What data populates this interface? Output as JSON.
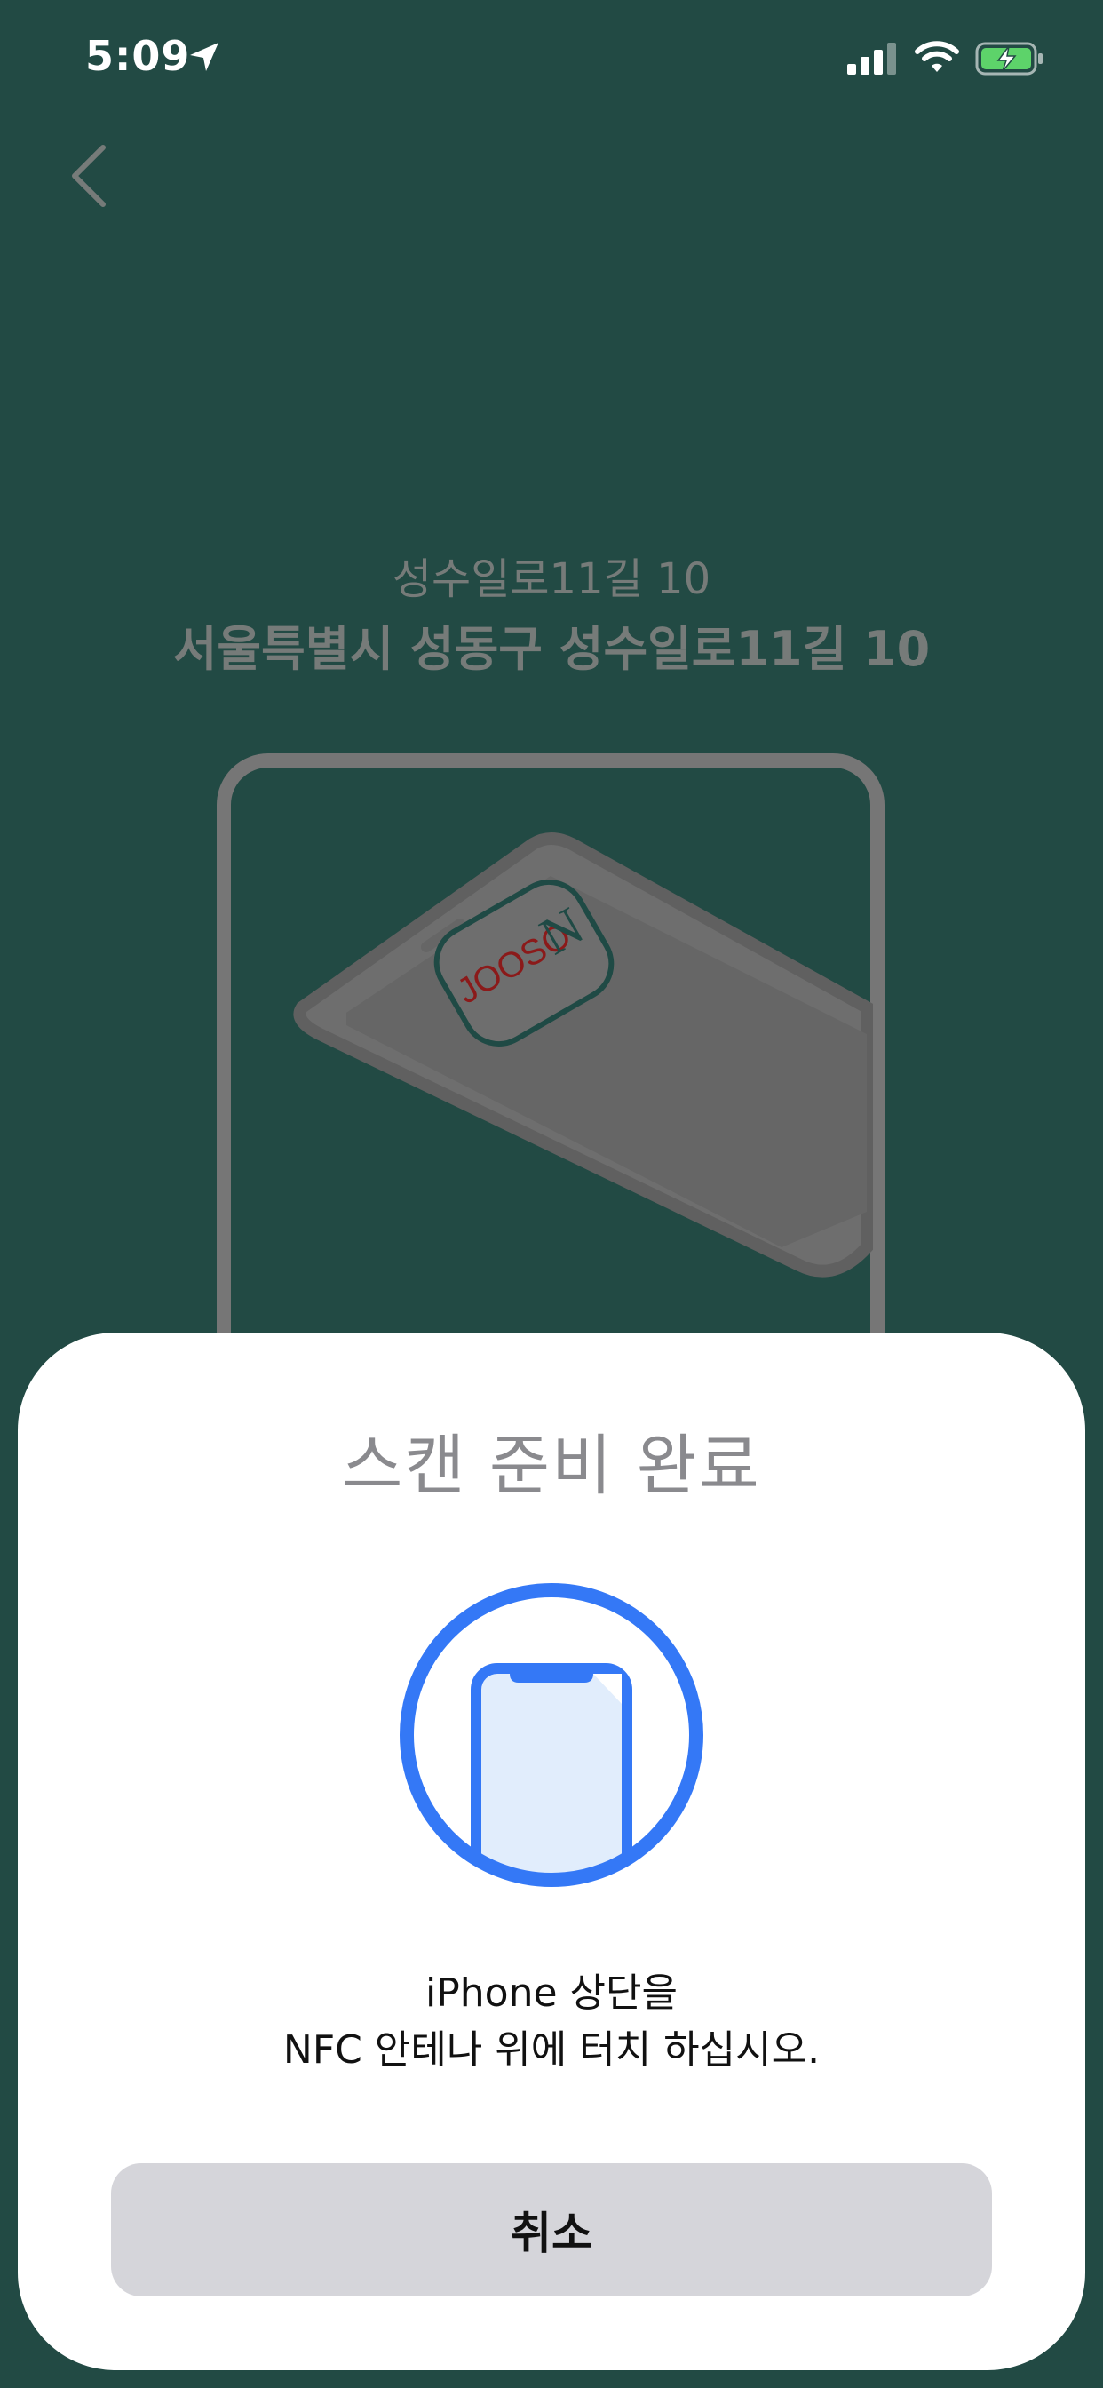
{
  "status_bar": {
    "time": "5:09",
    "location_icon": "location-arrow-icon",
    "signal_icon": "cellular-signal-icon",
    "wifi_icon": "wifi-icon",
    "battery_icon": "battery-charging-icon"
  },
  "header": {
    "back_icon": "chevron-left-icon"
  },
  "place": {
    "name": "성수일로11길 10",
    "address": "서울특별시 성동구 성수일로11길 10"
  },
  "illustration": {
    "logo_text": "JOOSO"
  },
  "nfc_sheet": {
    "title": "스캔 준비 완료",
    "instruction_line1": "iPhone 상단을",
    "instruction_line2": "NFC 안테나 위에 터치 하십시오.",
    "cancel_label": "취소",
    "accent_color": "#3478f6"
  },
  "colors": {
    "background": "#224a44",
    "sheet": "#ffffff",
    "cancel_button": "#d5d5da"
  }
}
